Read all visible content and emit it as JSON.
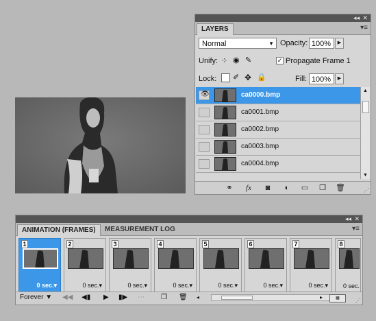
{
  "layers_panel": {
    "tab_label": "LAYERS",
    "blend_mode": "Normal",
    "opacity_label": "Opacity:",
    "opacity_value": "100%",
    "unify_label": "Unify:",
    "propagate_label": "Propagate Frame 1",
    "propagate_checked": true,
    "lock_label": "Lock:",
    "fill_label": "Fill:",
    "fill_value": "100%",
    "layers": [
      {
        "name": "ca0000.bmp",
        "selected": true,
        "visible": true
      },
      {
        "name": "ca0001.bmp",
        "selected": false,
        "visible": false
      },
      {
        "name": "ca0002.bmp",
        "selected": false,
        "visible": false
      },
      {
        "name": "ca0003.bmp",
        "selected": false,
        "visible": false
      },
      {
        "name": "ca0004.bmp",
        "selected": false,
        "visible": false
      }
    ],
    "bottom_icons": [
      "link-layers-icon",
      "fx-icon",
      "layer-mask-icon",
      "adjustment-layer-icon",
      "new-group-icon",
      "new-layer-icon",
      "trash-icon"
    ]
  },
  "animation_panel": {
    "tabs": [
      {
        "label": "ANIMATION (FRAMES)",
        "active": true
      },
      {
        "label": "MEASUREMENT LOG",
        "active": false
      }
    ],
    "frames": [
      {
        "number": "1",
        "delay": "0 sec.",
        "selected": true
      },
      {
        "number": "2",
        "delay": "0 sec.",
        "selected": false
      },
      {
        "number": "3",
        "delay": "0 sec.",
        "selected": false
      },
      {
        "number": "4",
        "delay": "0 sec.",
        "selected": false
      },
      {
        "number": "5",
        "delay": "0 sec.",
        "selected": false
      },
      {
        "number": "6",
        "delay": "0 sec.",
        "selected": false
      },
      {
        "number": "7",
        "delay": "0 sec.",
        "selected": false
      },
      {
        "number": "8",
        "delay": "0 sec.",
        "selected": false
      }
    ],
    "loop_option": "Forever",
    "controls": [
      "first-frame-icon",
      "previous-frame-icon",
      "play-icon",
      "next-frame-icon",
      "tween-icon",
      "duplicate-frame-icon",
      "delete-frame-icon"
    ]
  },
  "colors": {
    "selection": "#3d97e8",
    "panel_bg": "#d6d6d6",
    "titlebar": "#545454",
    "workspace": "#b8b8b8"
  }
}
